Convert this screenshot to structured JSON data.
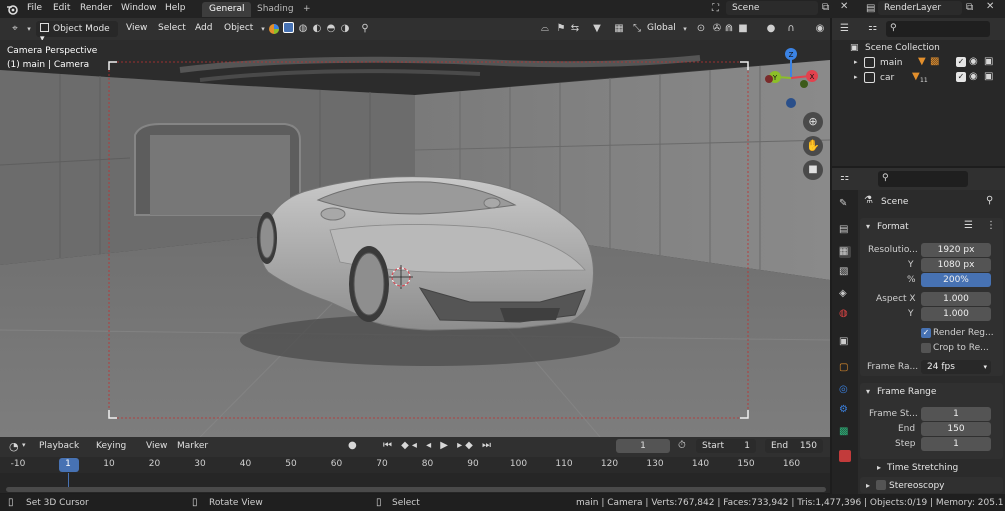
{
  "topbar": {
    "menus": [
      "File",
      "Edit",
      "Render",
      "Window",
      "Help"
    ],
    "workspace_tabs": [
      "General",
      "Shading",
      "+"
    ],
    "scene": "Scene",
    "view_layer": "RenderLayer"
  },
  "viewport_header": {
    "mode": "Object Mode",
    "menus": [
      "View",
      "Select",
      "Add",
      "Object"
    ],
    "transform_orientation": "Global"
  },
  "viewport": {
    "view_name": "Camera Perspective",
    "object_info": "(1) main | Camera",
    "gizmo_axes": [
      "Z",
      "Y",
      "X"
    ]
  },
  "timeline": {
    "menus": [
      "Playback",
      "Keying",
      "View",
      "Marker"
    ],
    "current_frame": "1",
    "start_label": "Start",
    "start": "1",
    "end_label": "End",
    "end": "150",
    "ruler_ticks": [
      "-10",
      "1",
      "10",
      "20",
      "30",
      "40",
      "50",
      "60",
      "70",
      "80",
      "90",
      "100",
      "110",
      "120",
      "130",
      "140",
      "150",
      "160"
    ]
  },
  "statusbar": {
    "hint_left": "Set 3D Cursor",
    "hint_middle": "Rotate View",
    "hint_right": "Select",
    "stats": "main | Camera | Verts:767,842 | Faces:733,942 | Tris:1,477,396 | Objects:0/19 | Memory: 205.1 MiB |"
  },
  "outliner": {
    "root": "Scene Collection",
    "items": [
      {
        "name": "main",
        "badge": ""
      },
      {
        "name": "car",
        "badge": "11"
      }
    ]
  },
  "properties": {
    "context": "Scene",
    "format_panel": {
      "title": "Format",
      "resolution_label": "Resolutio...",
      "res_x": "1920 px",
      "y_label": "Y",
      "res_y": "1080 px",
      "percent_label": "%",
      "res_percent": "200%",
      "aspect_label": "Aspect X",
      "aspect_x": "1.000",
      "aspect_y_label": "Y",
      "aspect_y": "1.000",
      "render_region": "Render Reg...",
      "crop": "Crop to Re...",
      "frame_rate_label": "Frame Ra...",
      "frame_rate": "24 fps"
    },
    "frame_range_panel": {
      "title": "Frame Range",
      "start_label": "Frame St...",
      "start": "1",
      "end_label": "End",
      "end": "150",
      "step_label": "Step",
      "step": "1"
    },
    "time_stretching": "Time Stretching",
    "stereoscopy": "Stereoscopy"
  },
  "colors": {
    "accent_blue": "#4772b3",
    "x_axis": "#e2424e",
    "y_axis": "#8cbf28",
    "z_axis": "#3b83e4"
  }
}
